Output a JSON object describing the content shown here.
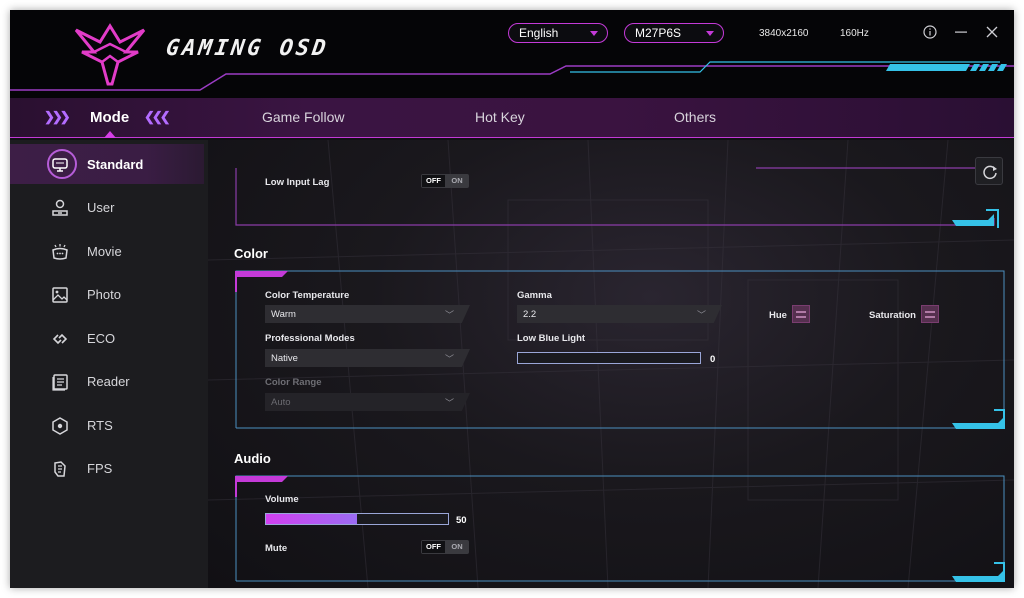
{
  "header": {
    "logo_text": "GAMING OSD",
    "language": "English",
    "model": "M27P6S",
    "resolution": "3840x2160",
    "refresh_rate": "160Hz",
    "icons": [
      "info-icon",
      "minimize-icon",
      "close-icon"
    ]
  },
  "tabs": {
    "mode": "Mode",
    "game_follow": "Game Follow",
    "hot_key": "Hot Key",
    "others": "Others"
  },
  "sidebar": {
    "items": [
      {
        "label": "Standard",
        "icon": "monitor-icon",
        "active": true
      },
      {
        "label": "User",
        "icon": "user-icon",
        "active": false
      },
      {
        "label": "Movie",
        "icon": "movie-icon",
        "active": false
      },
      {
        "label": "Photo",
        "icon": "photo-icon",
        "active": false
      },
      {
        "label": "ECO",
        "icon": "eco-icon",
        "active": false
      },
      {
        "label": "Reader",
        "icon": "reader-icon",
        "active": false
      },
      {
        "label": "RTS",
        "icon": "rts-icon",
        "active": false
      },
      {
        "label": "FPS",
        "icon": "fps-icon",
        "active": false
      }
    ]
  },
  "top_section": {
    "low_input_lag": {
      "label": "Low Input Lag",
      "off": "OFF",
      "on": "ON",
      "state": "OFF"
    }
  },
  "color": {
    "title": "Color",
    "color_temperature": {
      "label": "Color Temperature",
      "value": "Warm"
    },
    "gamma": {
      "label": "Gamma",
      "value": "2.2"
    },
    "hue": {
      "label": "Hue"
    },
    "saturation": {
      "label": "Saturation"
    },
    "professional_modes": {
      "label": "Professional Modes",
      "value": "Native"
    },
    "low_blue_light": {
      "label": "Low Blue Light",
      "value": 0,
      "value_text": "0",
      "max": 100
    },
    "color_range": {
      "label": "Color Range",
      "value": "Auto",
      "disabled": true
    }
  },
  "audio": {
    "title": "Audio",
    "volume": {
      "label": "Volume",
      "value": 50,
      "value_text": "50",
      "max": 100
    },
    "mute": {
      "label": "Mute",
      "off": "OFF",
      "on": "ON",
      "state": "OFF"
    }
  },
  "colors": {
    "accent_magenta": "#c43ad8",
    "accent_cyan": "#35c2e8",
    "background": "#101014",
    "sidebar": "#1c1c1f"
  }
}
